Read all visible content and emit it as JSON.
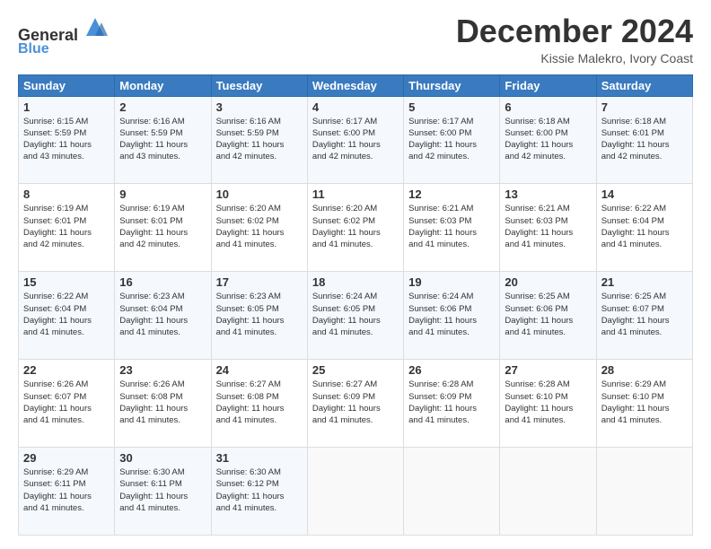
{
  "header": {
    "logo_line1": "General",
    "logo_line2": "Blue",
    "month_title": "December 2024",
    "subtitle": "Kissie Malekro, Ivory Coast"
  },
  "weekdays": [
    "Sunday",
    "Monday",
    "Tuesday",
    "Wednesday",
    "Thursday",
    "Friday",
    "Saturday"
  ],
  "weeks": [
    [
      {
        "day": 1,
        "sunrise": "6:15 AM",
        "sunset": "5:59 PM",
        "daylight": "11 hours and 43 minutes."
      },
      {
        "day": 2,
        "sunrise": "6:16 AM",
        "sunset": "5:59 PM",
        "daylight": "11 hours and 43 minutes."
      },
      {
        "day": 3,
        "sunrise": "6:16 AM",
        "sunset": "5:59 PM",
        "daylight": "11 hours and 42 minutes."
      },
      {
        "day": 4,
        "sunrise": "6:17 AM",
        "sunset": "6:00 PM",
        "daylight": "11 hours and 42 minutes."
      },
      {
        "day": 5,
        "sunrise": "6:17 AM",
        "sunset": "6:00 PM",
        "daylight": "11 hours and 42 minutes."
      },
      {
        "day": 6,
        "sunrise": "6:18 AM",
        "sunset": "6:00 PM",
        "daylight": "11 hours and 42 minutes."
      },
      {
        "day": 7,
        "sunrise": "6:18 AM",
        "sunset": "6:01 PM",
        "daylight": "11 hours and 42 minutes."
      }
    ],
    [
      {
        "day": 8,
        "sunrise": "6:19 AM",
        "sunset": "6:01 PM",
        "daylight": "11 hours and 42 minutes."
      },
      {
        "day": 9,
        "sunrise": "6:19 AM",
        "sunset": "6:01 PM",
        "daylight": "11 hours and 42 minutes."
      },
      {
        "day": 10,
        "sunrise": "6:20 AM",
        "sunset": "6:02 PM",
        "daylight": "11 hours and 41 minutes."
      },
      {
        "day": 11,
        "sunrise": "6:20 AM",
        "sunset": "6:02 PM",
        "daylight": "11 hours and 41 minutes."
      },
      {
        "day": 12,
        "sunrise": "6:21 AM",
        "sunset": "6:03 PM",
        "daylight": "11 hours and 41 minutes."
      },
      {
        "day": 13,
        "sunrise": "6:21 AM",
        "sunset": "6:03 PM",
        "daylight": "11 hours and 41 minutes."
      },
      {
        "day": 14,
        "sunrise": "6:22 AM",
        "sunset": "6:04 PM",
        "daylight": "11 hours and 41 minutes."
      }
    ],
    [
      {
        "day": 15,
        "sunrise": "6:22 AM",
        "sunset": "6:04 PM",
        "daylight": "11 hours and 41 minutes."
      },
      {
        "day": 16,
        "sunrise": "6:23 AM",
        "sunset": "6:04 PM",
        "daylight": "11 hours and 41 minutes."
      },
      {
        "day": 17,
        "sunrise": "6:23 AM",
        "sunset": "6:05 PM",
        "daylight": "11 hours and 41 minutes."
      },
      {
        "day": 18,
        "sunrise": "6:24 AM",
        "sunset": "6:05 PM",
        "daylight": "11 hours and 41 minutes."
      },
      {
        "day": 19,
        "sunrise": "6:24 AM",
        "sunset": "6:06 PM",
        "daylight": "11 hours and 41 minutes."
      },
      {
        "day": 20,
        "sunrise": "6:25 AM",
        "sunset": "6:06 PM",
        "daylight": "11 hours and 41 minutes."
      },
      {
        "day": 21,
        "sunrise": "6:25 AM",
        "sunset": "6:07 PM",
        "daylight": "11 hours and 41 minutes."
      }
    ],
    [
      {
        "day": 22,
        "sunrise": "6:26 AM",
        "sunset": "6:07 PM",
        "daylight": "11 hours and 41 minutes."
      },
      {
        "day": 23,
        "sunrise": "6:26 AM",
        "sunset": "6:08 PM",
        "daylight": "11 hours and 41 minutes."
      },
      {
        "day": 24,
        "sunrise": "6:27 AM",
        "sunset": "6:08 PM",
        "daylight": "11 hours and 41 minutes."
      },
      {
        "day": 25,
        "sunrise": "6:27 AM",
        "sunset": "6:09 PM",
        "daylight": "11 hours and 41 minutes."
      },
      {
        "day": 26,
        "sunrise": "6:28 AM",
        "sunset": "6:09 PM",
        "daylight": "11 hours and 41 minutes."
      },
      {
        "day": 27,
        "sunrise": "6:28 AM",
        "sunset": "6:10 PM",
        "daylight": "11 hours and 41 minutes."
      },
      {
        "day": 28,
        "sunrise": "6:29 AM",
        "sunset": "6:10 PM",
        "daylight": "11 hours and 41 minutes."
      }
    ],
    [
      {
        "day": 29,
        "sunrise": "6:29 AM",
        "sunset": "6:11 PM",
        "daylight": "11 hours and 41 minutes."
      },
      {
        "day": 30,
        "sunrise": "6:30 AM",
        "sunset": "6:11 PM",
        "daylight": "11 hours and 41 minutes."
      },
      {
        "day": 31,
        "sunrise": "6:30 AM",
        "sunset": "6:12 PM",
        "daylight": "11 hours and 41 minutes."
      },
      null,
      null,
      null,
      null
    ]
  ]
}
